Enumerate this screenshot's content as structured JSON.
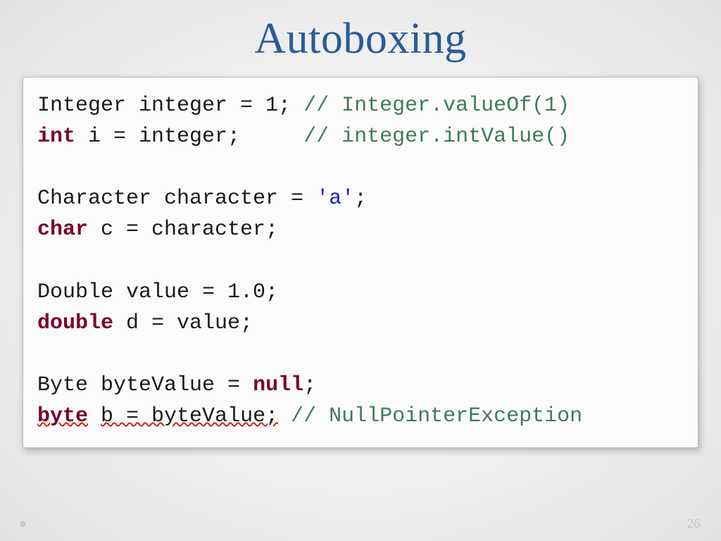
{
  "title": "Autoboxing",
  "page_number": "26",
  "code": {
    "l1a": "Integer integer = 1; ",
    "l1c": "// Integer.valueOf(1)",
    "l2kw": "int",
    "l2a": " i = integer;     ",
    "l2c": "// integer.intValue()",
    "l3": "",
    "l4a": "Character character = ",
    "l4s": "'a'",
    "l4b": ";",
    "l5kw": "char",
    "l5a": " c = character;",
    "l6": "",
    "l7a": "Double value = 1.0;",
    "l8kw": "double",
    "l8a": " d = value;",
    "l9": "",
    "l10a": "Byte byteValue = ",
    "l10kw": "null",
    "l10b": ";",
    "l11kw": "byte",
    "l11sp": " ",
    "l11sq": "b = byteValue;",
    "l11sp2": " ",
    "l11c": "// NullPointerException"
  }
}
